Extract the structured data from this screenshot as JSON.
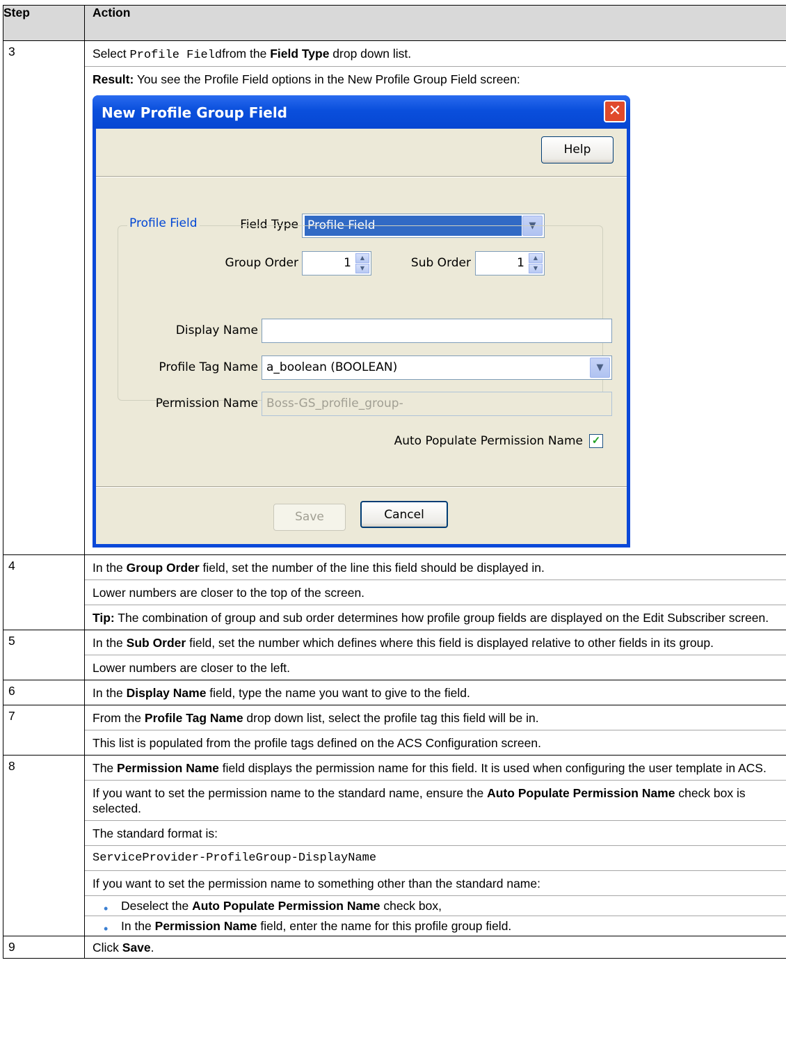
{
  "table": {
    "header": {
      "step": "Step",
      "action": "Action"
    }
  },
  "rows": {
    "r3": {
      "step": "3",
      "p1": {
        "pre": "Select ",
        "code": "Profile Field",
        "mid": "from the ",
        "bold": "Field Type",
        "post": " drop down list."
      },
      "p2": {
        "bold": "Result:",
        "post": " You see the Profile Field options in the New Profile Group Field screen:"
      }
    },
    "r4": {
      "step": "4",
      "p1": {
        "pre": "In the ",
        "bold": "Group Order",
        "post": " field, set the number of the line this field should be displayed in."
      },
      "p2": "Lower numbers are closer to the top of the screen.",
      "p3": {
        "bold": "Tip:",
        "post": " The combination of group and sub order determines how profile group fields are displayed on the Edit Subscriber screen."
      }
    },
    "r5": {
      "step": "5",
      "p1": {
        "pre": "In the ",
        "bold": "Sub Order",
        "post": " field, set the number which defines where this field is displayed relative to other fields in its group."
      },
      "p2": "Lower numbers are closer to the left."
    },
    "r6": {
      "step": "6",
      "p1": {
        "pre": "In the ",
        "bold": "Display Name",
        "post": " field, type the name you want to give to the field."
      }
    },
    "r7": {
      "step": "7",
      "p1": {
        "pre": "From the ",
        "bold": "Profile Tag Name",
        "post": " drop down list, select the profile tag this field will be in."
      },
      "p2": "This list is populated from the profile tags defined on the ACS Configuration screen."
    },
    "r8": {
      "step": "8",
      "p1": {
        "pre": "The ",
        "bold": "Permission Name",
        "post": " field displays the permission name for this field. It is used when configuring the user template in ACS."
      },
      "p2": {
        "pre": "If you want to set the permission name to the standard name, ensure the ",
        "bold": "Auto Populate Permission Name",
        "post": " check box is selected."
      },
      "p3": "The standard format is:",
      "p4": "ServiceProvider-ProfileGroup-DisplayName",
      "p5": "If you want to set the permission name to something other than the standard name:",
      "b1": {
        "pre": "Deselect the ",
        "bold": "Auto Populate Permission Name",
        "post": " check box,"
      },
      "b2": {
        "pre": "In the ",
        "bold": "Permission Name",
        "post": " field, enter the name for this profile group field."
      }
    },
    "r9": {
      "step": "9",
      "p1": {
        "pre": "Click ",
        "bold": "Save",
        "post": "."
      }
    }
  },
  "dialog": {
    "title": "New Profile Group Field",
    "close_glyph": "✕",
    "help_label": "Help",
    "field_type_label": "Field Type",
    "field_type_value": "Profile Field",
    "group_order_label": "Group Order",
    "group_order_value": "1",
    "sub_order_label": "Sub Order",
    "sub_order_value": "1",
    "groupbox_label": "Profile Field",
    "display_name_label": "Display Name",
    "display_name_value": "",
    "profile_tag_label": "Profile Tag Name",
    "profile_tag_value": "a_boolean (BOOLEAN)",
    "permission_name_label": "Permission Name",
    "permission_name_value": "Boss-GS_profile_group-",
    "auto_populate_label": "Auto Populate Permission Name",
    "auto_populate_checked": true,
    "save_label": "Save",
    "cancel_label": "Cancel",
    "dropdown_glyph": "▼",
    "spin_up_glyph": "▲",
    "spin_down_glyph": "▼",
    "check_glyph": "✓"
  },
  "colors": {
    "titlebar": "#0a4fdc",
    "dialog_bg": "#ece9d8",
    "bullet": "#3b7fd2",
    "groupbox_label": "#0046d5"
  },
  "bullet_glyph": "•"
}
